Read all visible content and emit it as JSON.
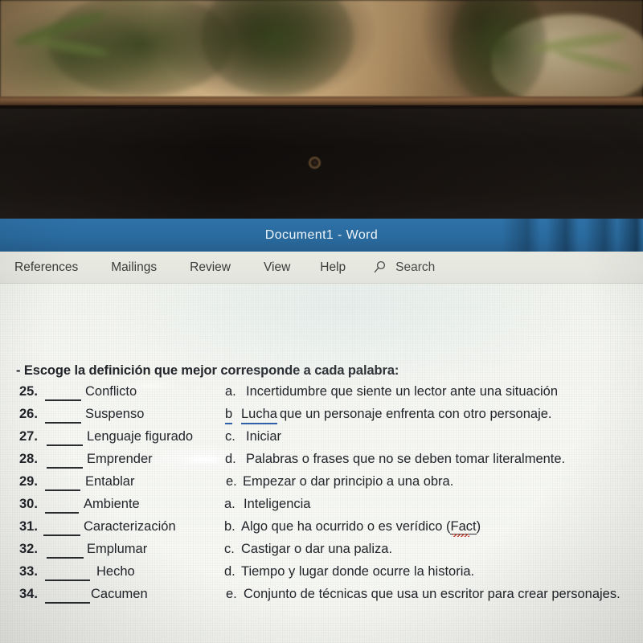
{
  "window": {
    "title": "Document1  -  Word"
  },
  "ribbon": {
    "tabs": [
      {
        "label": "References"
      },
      {
        "label": "Mailings"
      },
      {
        "label": "Review"
      },
      {
        "label": "View"
      },
      {
        "label": "Help"
      }
    ],
    "search": {
      "label": "Search",
      "icon": "search-icon"
    }
  },
  "document": {
    "heading": "- Escoge la definición que mejor corresponde a cada palabra:",
    "block1": {
      "items": [
        {
          "number": "25.",
          "word": "Conflicto"
        },
        {
          "number": "26.",
          "word": "Suspenso"
        },
        {
          "number": "27.",
          "word": "Lenguaje figurado"
        },
        {
          "number": "28.",
          "word": "Emprender"
        },
        {
          "number": "29.",
          "word": "Entablar"
        }
      ],
      "answers": [
        {
          "letter": "a.",
          "text": "Incertidumbre que siente un lector ante una situación"
        },
        {
          "letter": "b",
          "text": "Lucha",
          "rest": " que un personaje enfrenta con otro personaje.",
          "underlined": true
        },
        {
          "letter": "c.",
          "text": "Iniciar"
        },
        {
          "letter": "d.",
          "text": "Palabras o frases que no se deben tomar literalmente."
        },
        {
          "letter": "e.",
          "text": "Empezar o dar principio a una obra."
        }
      ]
    },
    "block2": {
      "items": [
        {
          "number": "30.",
          "word": "Ambiente"
        },
        {
          "number": "31.",
          "word": "Caracterización"
        },
        {
          "number": "32.",
          "word": "Emplumar"
        },
        {
          "number": "33.",
          "word": "Hecho"
        },
        {
          "number": "34.",
          "word": "Cacumen"
        }
      ],
      "answers": [
        {
          "letter": "a.",
          "text": "Inteligencia"
        },
        {
          "letter": "b.",
          "text": "Algo que ha ocurrido o es verídico (",
          "misspelled": "Fact",
          "after": ")"
        },
        {
          "letter": "c.",
          "text": "Castigar o dar una paliza."
        },
        {
          "letter": "d.",
          "text": "Tiempo y lugar donde ocurre la historia."
        },
        {
          "letter": "e.",
          "text": "Conjunto de técnicas que usa un escritor para crear personajes."
        }
      ]
    }
  },
  "colors": {
    "titlebar": "#2a6b9f",
    "ribbon": "#e6e7df",
    "page": "#f7f7f3",
    "link_underline": "#2f5fa8",
    "spellcheck": "#c0392b"
  }
}
